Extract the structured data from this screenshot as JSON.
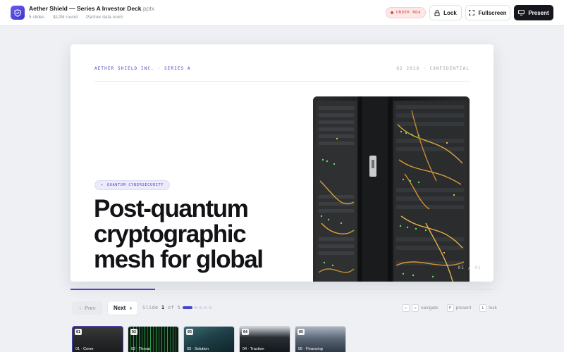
{
  "header": {
    "file_name": "Aether Shield — Series A Investor Deck",
    "file_ext": ".pptx",
    "meta": [
      "5 slides",
      "$12M round",
      "Partner data room"
    ],
    "badge": "UNDER NDA",
    "lock_label": "Lock",
    "fullscreen_label": "Fullscreen",
    "present_label": "Present"
  },
  "slide": {
    "company": "AETHER SHIELD INC. · SERIES A",
    "confidential": "Q2 2026 · CONFIDENTIAL",
    "tag": "QUANTUM CYBERSECURITY",
    "headline": "Post-quantum cryptographic mesh for global",
    "number": "01 / 05"
  },
  "progress": {
    "current": 1,
    "total": 5,
    "fraction": 0.2
  },
  "controls": {
    "prev_label": "Prev",
    "next_label": "Next",
    "counter_prefix": "Slide",
    "counter_current": "1",
    "counter_of": "of",
    "counter_total": "5"
  },
  "hints": {
    "key_left": "←",
    "key_right": "→",
    "navigate": "navigate",
    "key_f": "F",
    "present": "present",
    "key_l": "L",
    "lock": "lock"
  },
  "thumbnails": [
    {
      "num": "01",
      "label": "01 · Cover"
    },
    {
      "num": "02",
      "label": "02 · Threat"
    },
    {
      "num": "03",
      "label": "03 · Solution"
    },
    {
      "num": "04",
      "label": "04 · Traction"
    },
    {
      "num": "05",
      "label": "05 · Financing"
    }
  ],
  "colors": {
    "accent": "#4a45c8",
    "danger": "#d23b3b",
    "ink": "#16181d"
  }
}
